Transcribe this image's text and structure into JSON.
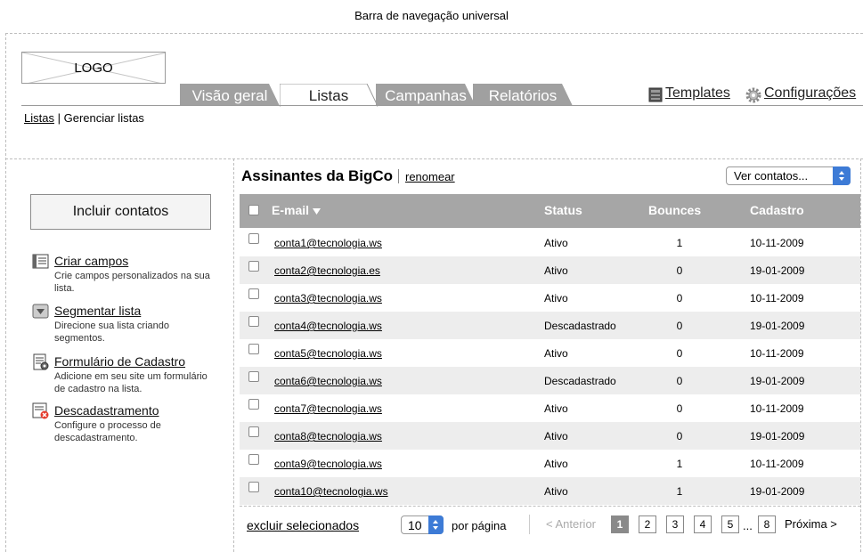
{
  "universal_nav": {
    "label": "Barra de navegação universal"
  },
  "logo": {
    "label": "LOGO"
  },
  "tabs": [
    {
      "label": "Visão geral",
      "active": false
    },
    {
      "label": "Listas",
      "active": true
    },
    {
      "label": "Campanhas",
      "active": false
    },
    {
      "label": "Relatórios",
      "active": false
    }
  ],
  "top_links": {
    "templates": "Templates",
    "settings": "Configurações"
  },
  "breadcrumb": {
    "parent": "Listas",
    "separator": "|",
    "current": "Gerenciar listas"
  },
  "sidebar": {
    "include_button": "Incluir contatos",
    "items": [
      {
        "title": "Criar campos",
        "description": "Crie campos personalizados na sua lista."
      },
      {
        "title": "Segmentar lista",
        "description": "Direcione sua lista criando segmentos."
      },
      {
        "title": "Formulário de Cadastro",
        "description": "Adicione em seu site um formulário de cadastro na lista."
      },
      {
        "title": "Descadastramento",
        "description": "Configure o processo de descadastramento."
      }
    ]
  },
  "panel": {
    "title": "Assinantes da BigCo",
    "rename": "renomear",
    "view_select": "Ver contatos..."
  },
  "table": {
    "headers": {
      "email": "E-mail",
      "status": "Status",
      "bounces": "Bounces",
      "date": "Cadastro"
    },
    "rows": [
      {
        "email": "conta1@tecnologia.ws",
        "status": "Ativo",
        "bounces": "1",
        "date": "10-11-2009"
      },
      {
        "email": "conta2@tecnologia.es",
        "status": "Ativo",
        "bounces": "0",
        "date": "19-01-2009"
      },
      {
        "email": "conta3@tecnologia.ws",
        "status": "Ativo",
        "bounces": "0",
        "date": "10-11-2009"
      },
      {
        "email": "conta4@tecnologia.ws",
        "status": "Descadastrado",
        "bounces": "0",
        "date": "19-01-2009"
      },
      {
        "email": "conta5@tecnologia.ws",
        "status": "Ativo",
        "bounces": "0",
        "date": "10-11-2009"
      },
      {
        "email": "conta6@tecnologia.ws",
        "status": "Descadastrado",
        "bounces": "0",
        "date": "19-01-2009"
      },
      {
        "email": "conta7@tecnologia.ws",
        "status": "Ativo",
        "bounces": "0",
        "date": "10-11-2009"
      },
      {
        "email": "conta8@tecnologia.ws",
        "status": "Ativo",
        "bounces": "0",
        "date": "19-01-2009"
      },
      {
        "email": "conta9@tecnologia.ws",
        "status": "Ativo",
        "bounces": "1",
        "date": "10-11-2009"
      },
      {
        "email": "conta10@tecnologia.ws",
        "status": "Ativo",
        "bounces": "1",
        "date": "19-01-2009"
      }
    ]
  },
  "footer": {
    "delete_selected": "excluir selecionados",
    "per_page_value": "10",
    "per_page_label": "por página",
    "prev": "< Anterior",
    "pages": [
      "1",
      "2",
      "3",
      "4",
      "5"
    ],
    "current_page": "1",
    "ellipsis": "...",
    "last_page": "8",
    "next": "Próxima >"
  },
  "colors": {
    "tab_inactive": "#a0a0a0",
    "header_bg": "#a6a6a6",
    "select_accent": "#3d7bd6",
    "row_alt": "#ededed"
  },
  "icons": [
    "templates-icon",
    "gear-icon",
    "fields-icon",
    "segment-icon",
    "form-icon",
    "unsubscribe-icon",
    "sort-desc-icon"
  ]
}
